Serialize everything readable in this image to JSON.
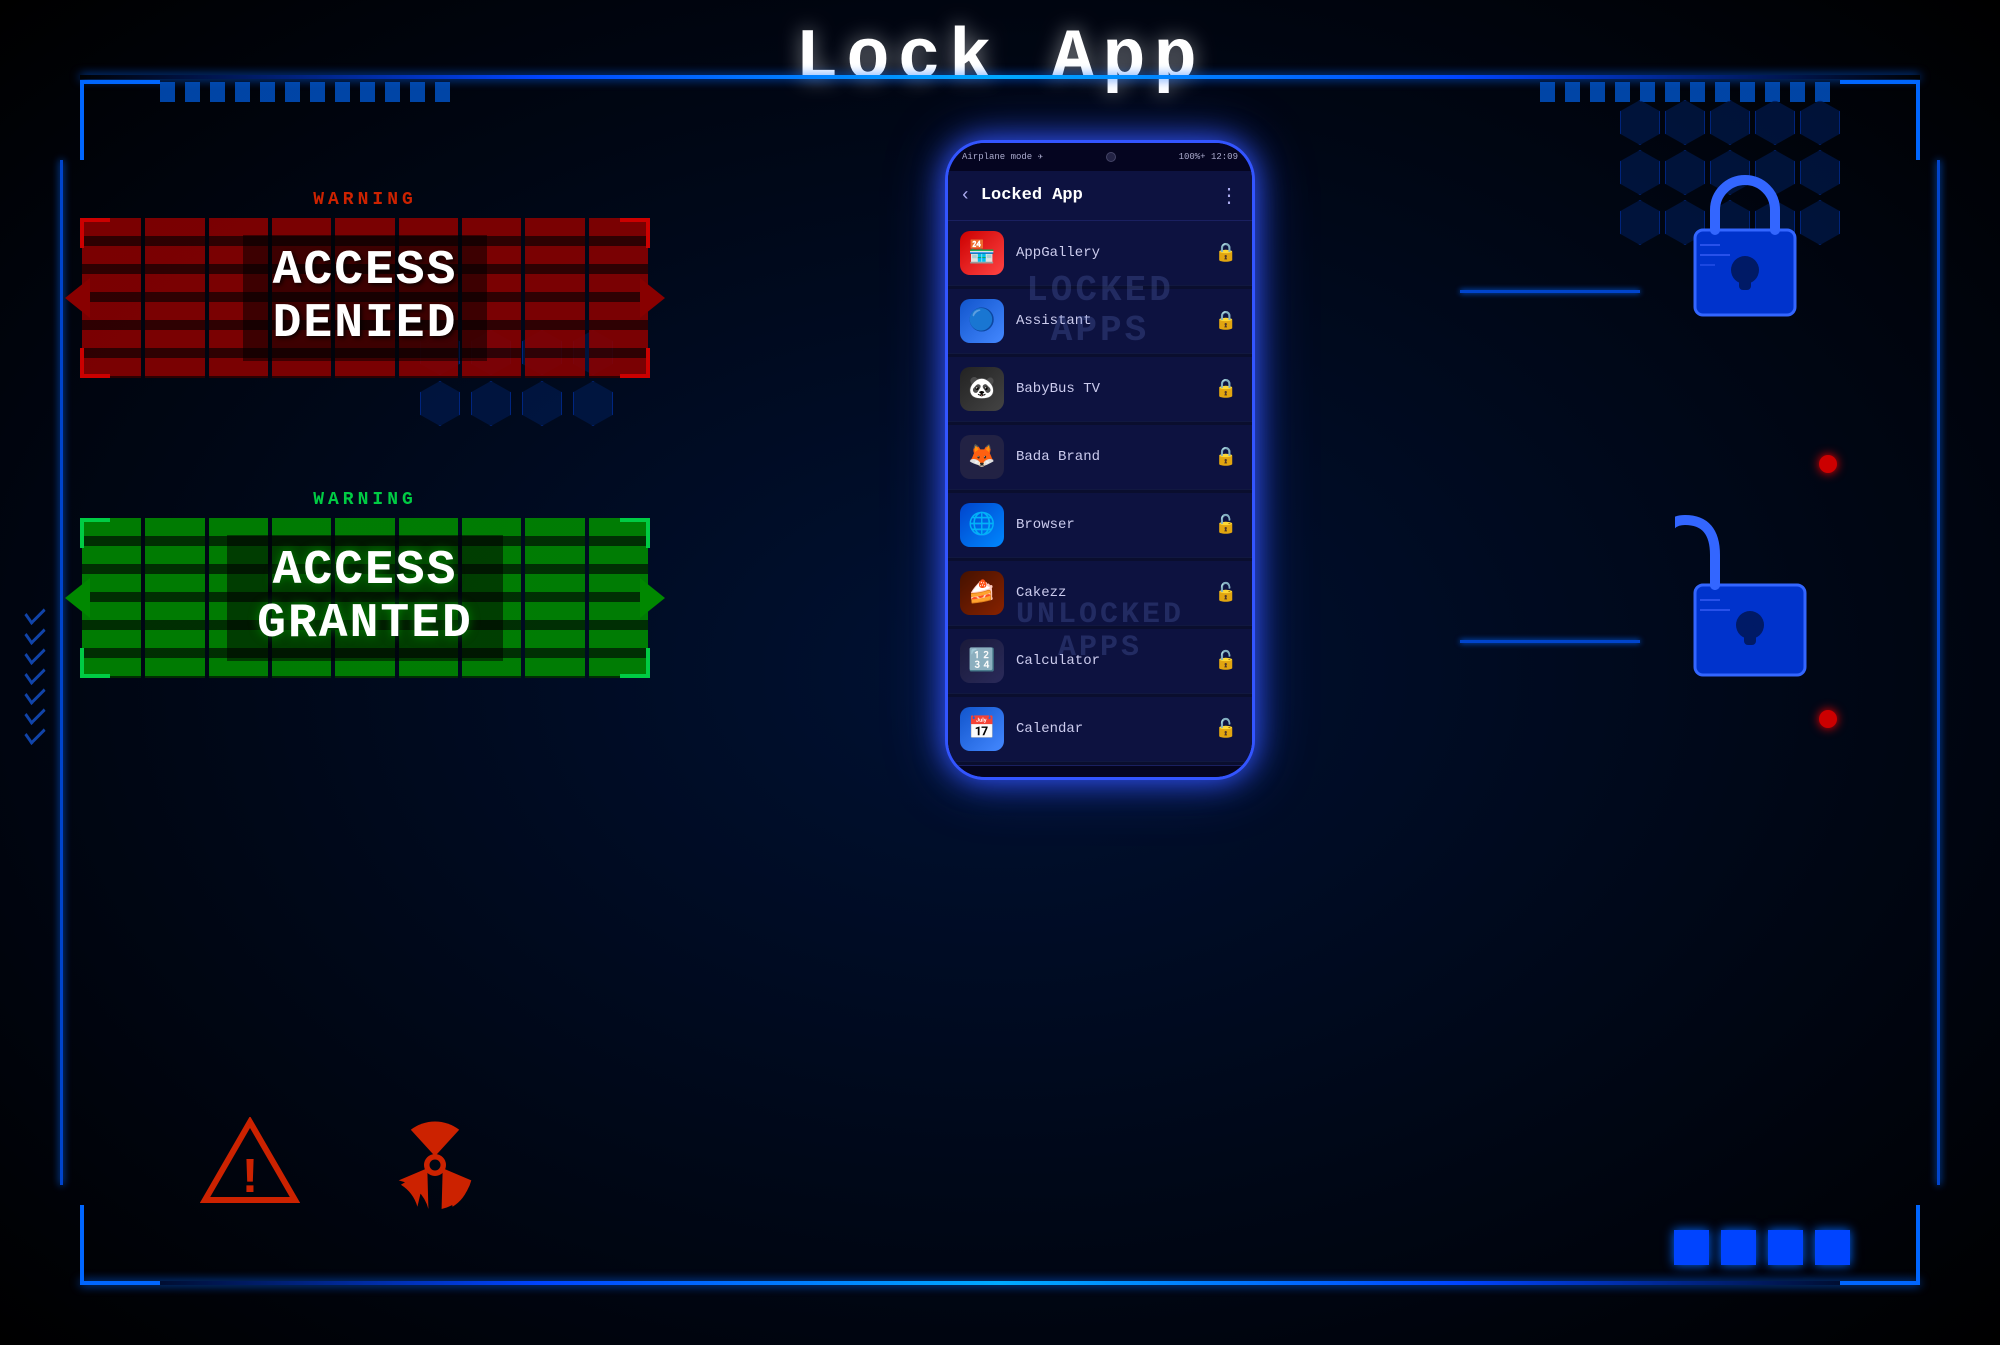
{
  "page": {
    "title": "Lock  App",
    "background_color": "#000a1a"
  },
  "header": {
    "title": "Lock  App"
  },
  "access_denied": {
    "warning": "WARNING",
    "line1": "ACCESS",
    "line2": "DENIED"
  },
  "access_granted": {
    "warning": "WARNING",
    "line1": "ACCESS",
    "line2": "GRANTED"
  },
  "phone": {
    "status_bar": {
      "left": "Airplane mode ✈",
      "center": "",
      "right": "100%+ 12:09"
    },
    "header": {
      "title": "Locked App",
      "back_label": "‹",
      "menu_label": "⋮"
    },
    "watermark_locked": "LOCKED\nAPPS",
    "watermark_unlocked": "UNLOCKED\nAPPS",
    "nav": {
      "back": "◁",
      "home": "○",
      "recent": "□"
    },
    "apps": [
      {
        "name": "AppGallery",
        "icon": "🏪",
        "icon_class": "icon-appgallery",
        "locked": true
      },
      {
        "name": "Assistant",
        "icon": "🔵",
        "icon_class": "icon-assistant",
        "locked": true
      },
      {
        "name": "BabyBus TV",
        "icon": "🐼",
        "icon_class": "icon-babybus",
        "locked": true
      },
      {
        "name": "Bada Brand",
        "icon": "🦊",
        "icon_class": "icon-bada",
        "locked": true
      },
      {
        "name": "Browser",
        "icon": "🌐",
        "icon_class": "icon-browser",
        "locked": false
      },
      {
        "name": "Cakezz",
        "icon": "🎂",
        "icon_class": "icon-cakezz",
        "locked": false
      },
      {
        "name": "Calculator",
        "icon": "🧮",
        "icon_class": "icon-calculator",
        "locked": false
      },
      {
        "name": "Calendar",
        "icon": "📅",
        "icon_class": "icon-calendar",
        "locked": false
      }
    ]
  },
  "icons": {
    "lock_locked": "🔒",
    "lock_unlocked": "🔓",
    "warning_triangle": "⚠",
    "radiation": "☢",
    "back_arrow": "‹",
    "menu_dots": "⋮",
    "nav_back": "◁",
    "nav_home": "○",
    "nav_recent": "□"
  }
}
